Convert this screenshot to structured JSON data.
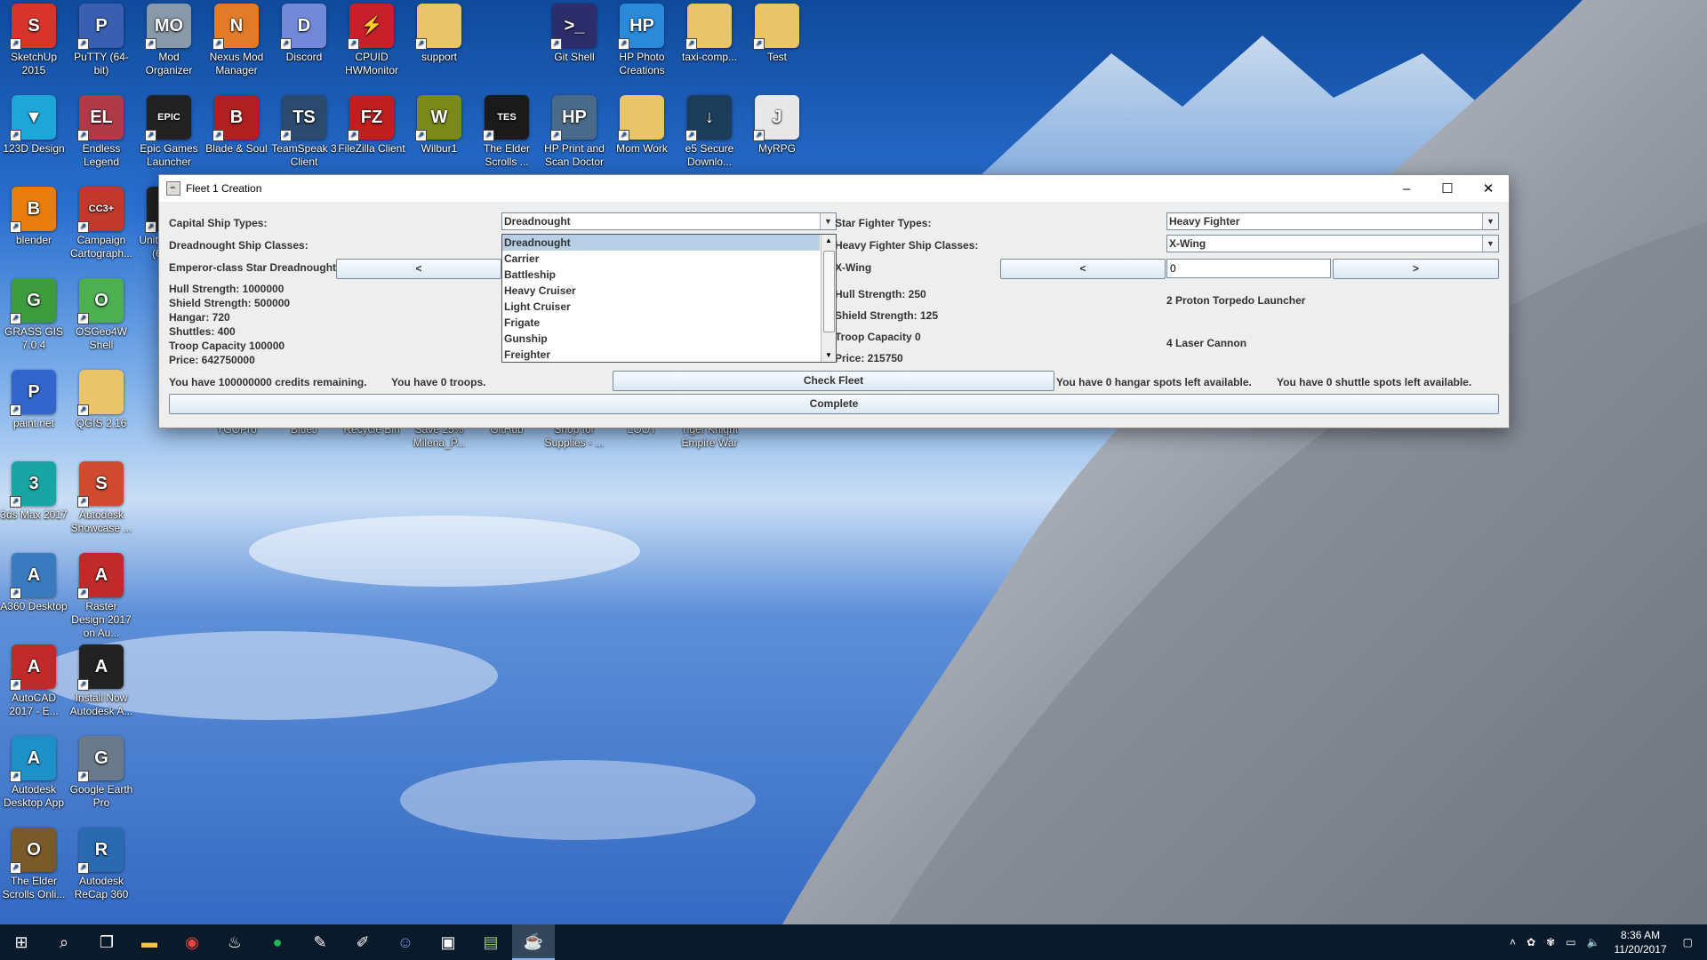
{
  "desktop": {
    "icons": [
      {
        "label": "SketchUp 2015",
        "glyph": "S",
        "color": "#d9342b"
      },
      {
        "label": "PuTTY (64-bit)",
        "glyph": "P",
        "color": "#3a5fb0"
      },
      {
        "label": "Mod Organizer",
        "glyph": "MO",
        "color": "#8899aa"
      },
      {
        "label": "Nexus Mod Manager",
        "glyph": "N",
        "color": "#e07b2a"
      },
      {
        "label": "Discord",
        "glyph": "D",
        "color": "#7289da"
      },
      {
        "label": "CPUID HWMonitor",
        "glyph": "⚡",
        "color": "#c8202a"
      },
      {
        "label": "support",
        "glyph": "",
        "color": "#e9c46a"
      },
      {
        "label": "Git Shell",
        "glyph": ">_",
        "color": "#2d2d6b"
      },
      {
        "label": "HP Photo Creations",
        "glyph": "HP",
        "color": "#2a89d8"
      },
      {
        "label": "taxi-comp...",
        "glyph": "",
        "color": "#e9c46a"
      },
      {
        "label": "Test",
        "glyph": "",
        "color": "#e9c46a"
      },
      {
        "label": "123D Design",
        "glyph": "▼",
        "color": "#1ea6d8"
      },
      {
        "label": "Endless Legend",
        "glyph": "EL",
        "color": "#b03a48"
      },
      {
        "label": "Epic Games Launcher",
        "glyph": "EPIC",
        "color": "#222222"
      },
      {
        "label": "Blade & Soul",
        "glyph": "B",
        "color": "#b02020"
      },
      {
        "label": "TeamSpeak 3 Client",
        "glyph": "TS",
        "color": "#2c4a6e"
      },
      {
        "label": "FileZilla Client",
        "glyph": "FZ",
        "color": "#bf1f1f"
      },
      {
        "label": "Wilbur1",
        "glyph": "W",
        "color": "#7a8a18"
      },
      {
        "label": "The Elder Scrolls ...",
        "glyph": "TES",
        "color": "#1a1a1a"
      },
      {
        "label": "HP Print and Scan Doctor",
        "glyph": "HP",
        "color": "#4a6a8a"
      },
      {
        "label": "Mom Work",
        "glyph": "",
        "color": "#e9c46a"
      },
      {
        "label": "e5 Secure Downlo...",
        "glyph": "↓",
        "color": "#1c3d5a"
      },
      {
        "label": "MyRPG",
        "glyph": "J",
        "color": "#e8e8e8"
      },
      {
        "label": "blender",
        "glyph": "B",
        "color": "#e87d0d"
      },
      {
        "label": "Campaign Cartograph...",
        "glyph": "CC3+",
        "color": "#c0392b"
      },
      {
        "label": "GRASS GIS 7.0.4",
        "glyph": "G",
        "color": "#3c9b3c"
      },
      {
        "label": "OSGeo4W Shell",
        "glyph": "O",
        "color": "#4caf50"
      },
      {
        "label": "paint.net",
        "glyph": "P",
        "color": "#3366cc"
      },
      {
        "label": "QGIS 2.16",
        "glyph": "",
        "color": "#e9c46a"
      },
      {
        "label": "Unity 5.5.5f1 (64-bit)",
        "glyph": "U",
        "color": "#222222"
      },
      {
        "label": "3ds Max 2017",
        "glyph": "3",
        "color": "#1aa5a5"
      },
      {
        "label": "Autodesk Showcase ...",
        "glyph": "S",
        "color": "#d04a30"
      },
      {
        "label": "A360 Desktop",
        "glyph": "A",
        "color": "#3a7bbf"
      },
      {
        "label": "Raster Design 2017 on Au...",
        "glyph": "A",
        "color": "#c02a2a"
      },
      {
        "label": "AutoCAD 2017 - E...",
        "glyph": "A",
        "color": "#c02a2a"
      },
      {
        "label": "Install Now Autodesk A...",
        "glyph": "A",
        "color": "#222222"
      },
      {
        "label": "Autodesk Desktop App",
        "glyph": "A",
        "color": "#1e90c8"
      },
      {
        "label": "Google Earth Pro",
        "glyph": "G",
        "color": "#6a7a8a"
      },
      {
        "label": "The Elder Scrolls Onli...",
        "glyph": "O",
        "color": "#7a5a2a"
      },
      {
        "label": "Autodesk ReCap 360",
        "glyph": "R",
        "color": "#2a6ab0"
      }
    ],
    "hidden_row": [
      "YGOPro",
      "BlueJ",
      "Recycle Bin",
      "Save 25% Milena_P...",
      "GitHub",
      "Shop for Supplies - ...",
      "LOOT",
      "Tiger Knight Empire War"
    ]
  },
  "window": {
    "title": "Fleet 1 Creation",
    "minimize": "–",
    "maximize": "☐",
    "close": "✕",
    "left": {
      "capital_types_label": "Capital Ship Types:",
      "capital_types_value": "Dreadnought",
      "classes_label": "Dreadnought Ship Classes:",
      "ship_name": "Emperor-class Star Dreadnought",
      "prev_button": "<",
      "stats": [
        "Hull Strength: 1000000",
        "Shield Strength: 500000",
        "Hangar: 720",
        "Shuttles: 400",
        "Troop Capacity 100000",
        "Price: 642750000"
      ]
    },
    "dropdown_options": [
      "Dreadnought",
      "Carrier",
      "Battleship",
      "Heavy Cruiser",
      "Light Cruiser",
      "Frigate",
      "Gunship",
      "Freighter"
    ],
    "right": {
      "fighter_types_label": "Star Fighter Types:",
      "fighter_types_value": "Heavy Fighter",
      "classes_label": "Heavy Fighter Ship Classes:",
      "classes_value": "X-Wing",
      "ship_name": "X-Wing",
      "prev_button": "<",
      "next_button": ">",
      "count_value": "0",
      "stats": [
        "Hull Strength: 250",
        "Shield Strength: 125",
        "Troop Capacity 0",
        "Price: 215750"
      ],
      "weapons": [
        "2 Proton Torpedo Launcher",
        "4 Laser Cannon"
      ]
    },
    "status": {
      "credits": "You have 100000000 credits remaining.",
      "troops": "You have 0 troops.",
      "hangar": "You have 0 hangar spots left available.",
      "shuttle": "You have 0 shuttle spots left available."
    },
    "check_fleet": "Check Fleet",
    "complete": "Complete"
  },
  "taskbar": {
    "time": "8:36 AM",
    "date": "11/20/2017"
  }
}
